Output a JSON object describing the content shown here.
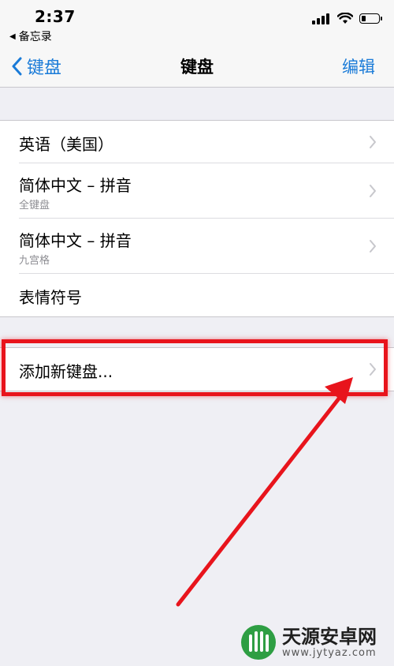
{
  "status_bar": {
    "time": "2:37",
    "back_app": "备忘录",
    "signal_bars": 4,
    "battery_level": 0.25
  },
  "nav": {
    "back_label": "键盘",
    "title": "键盘",
    "edit_label": "编辑"
  },
  "keyboards": [
    {
      "title": "英语（美国）",
      "subtitle": ""
    },
    {
      "title": "简体中文 – 拼音",
      "subtitle": "全键盘"
    },
    {
      "title": "简体中文 – 拼音",
      "subtitle": "九宫格"
    },
    {
      "title": "表情符号",
      "subtitle": ""
    }
  ],
  "add_keyboard_label": "添加新键盘...",
  "annotation": {
    "color": "#e8141c"
  },
  "watermark": {
    "name": "天源安卓网",
    "url": "www.jytyaz.com"
  },
  "colors": {
    "accent": "#1a7bd8",
    "background": "#efeff4",
    "separator": "#c8c7cc"
  }
}
